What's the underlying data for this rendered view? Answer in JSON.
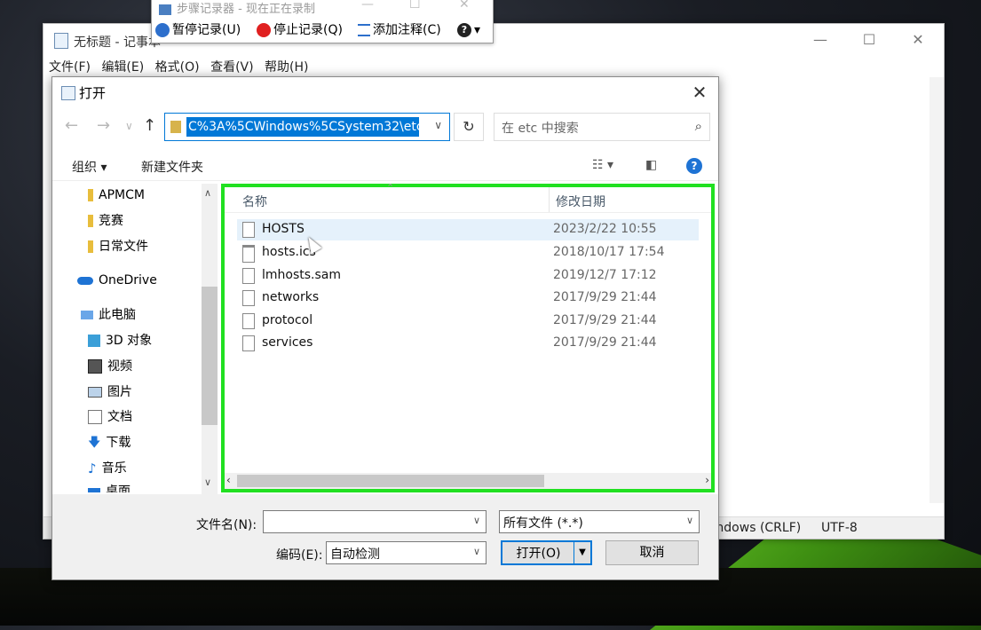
{
  "notepad": {
    "title": "无标题 - 记事本",
    "menu": [
      "文件(F)",
      "编辑(E)",
      "格式(O)",
      "查看(V)",
      "帮助(H)"
    ],
    "status": {
      "line_ending": "Windows (CRLF)",
      "encoding": "UTF-8"
    }
  },
  "recorder": {
    "title": "步骤记录器 - 现在正在录制",
    "pause": "暂停记录(U)",
    "stop": "停止记录(Q)",
    "comment": "添加注释(C)",
    "help": "?"
  },
  "dialog": {
    "title": "打开",
    "address": "C%3A%5CWindows%5CSystem32\\etc",
    "search_placeholder": "在 etc 中搜索",
    "organize": "组织 ▾",
    "new_folder": "新建文件夹",
    "nav": [
      {
        "label": "APMCM",
        "icon": "folder-icon"
      },
      {
        "label": "竞赛",
        "icon": "folder-icon"
      },
      {
        "label": "日常文件",
        "icon": "folder-icon"
      },
      {
        "label": "OneDrive",
        "icon": "cloud-icon"
      },
      {
        "label": "此电脑",
        "icon": "computer-icon"
      },
      {
        "label": "3D 对象",
        "icon": "cube-icon"
      },
      {
        "label": "视频",
        "icon": "video-icon"
      },
      {
        "label": "图片",
        "icon": "picture-icon"
      },
      {
        "label": "文档",
        "icon": "document-icon"
      },
      {
        "label": "下载",
        "icon": "download-icon"
      },
      {
        "label": "音乐",
        "icon": "music-icon"
      },
      {
        "label": "桌面",
        "icon": "desktop-icon"
      }
    ],
    "columns": {
      "name": "名称",
      "modified": "修改日期"
    },
    "files": [
      {
        "name": "HOSTS",
        "date": "2023/2/22 10:55"
      },
      {
        "name": "hosts.ics",
        "date": "2018/10/17 17:54"
      },
      {
        "name": "lmhosts.sam",
        "date": "2019/12/7 17:12"
      },
      {
        "name": "networks",
        "date": "2017/9/29 21:44"
      },
      {
        "name": "protocol",
        "date": "2017/9/29 21:44"
      },
      {
        "name": "services",
        "date": "2017/9/29 21:44"
      }
    ],
    "filename_label": "文件名(N):",
    "filename_value": "",
    "filetype": "所有文件 (*.*)",
    "encoding_label": "编码(E):",
    "encoding_value": "自动检测",
    "open_button": "打开(O)",
    "cancel_button": "取消"
  },
  "colors": {
    "accent": "#0078d7",
    "highlight_border": "#21e021"
  }
}
